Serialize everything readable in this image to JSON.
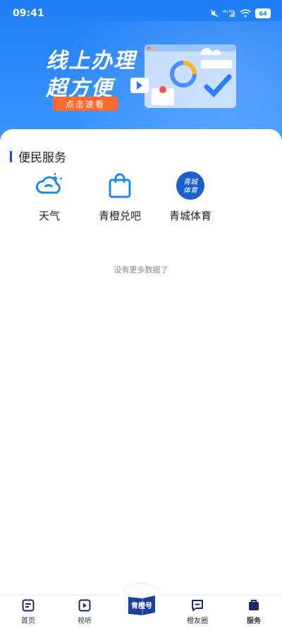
{
  "status_bar": {
    "time": "09:41",
    "network": "4G HD",
    "battery": "64"
  },
  "banner": {
    "line1": "线上办理",
    "line2": "超方便",
    "button": "点击速看"
  },
  "section": {
    "title": "便民服务"
  },
  "services": [
    {
      "label": "天气",
      "icon": "weather-icon"
    },
    {
      "label": "青橙兑吧",
      "icon": "shopping-bag-icon"
    },
    {
      "label": "青城体育",
      "icon": "qingcheng-sports-logo",
      "logo_text": "青城体育"
    }
  ],
  "empty_text": "没有更多数据了",
  "tabs": [
    {
      "label": "首页",
      "icon": "home-icon"
    },
    {
      "label": "视听",
      "icon": "play-icon"
    },
    {
      "label": "青橙号",
      "icon": "qingcheng-hao-icon"
    },
    {
      "label": "橙友圈",
      "icon": "chat-icon"
    },
    {
      "label": "服务",
      "icon": "service-icon",
      "active": true
    }
  ],
  "colors": {
    "header_blue": "#1f7ef6",
    "accent_orange": "#ff6a2a",
    "brand_blue": "#1d4ed8"
  }
}
